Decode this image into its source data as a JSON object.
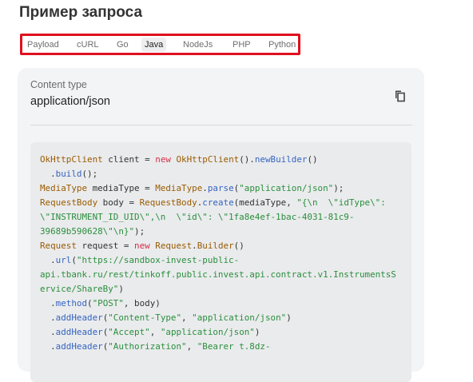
{
  "heading": "Пример запроса",
  "tabs": [
    "Payload",
    "cURL",
    "Go",
    "Java",
    "NodeJs",
    "PHP",
    "Python"
  ],
  "active_tab": "Java",
  "content_type": {
    "label": "Content type",
    "value": "application/json"
  },
  "copy_icon": "copy-icon",
  "code": {
    "language": "java",
    "lines": [
      [
        {
          "t": "OkHttpClient",
          "c": "ty"
        },
        {
          "t": " client = "
        },
        {
          "t": "new",
          "c": "kw"
        },
        {
          "t": " "
        },
        {
          "t": "OkHttpClient",
          "c": "ty"
        },
        {
          "t": "()."
        },
        {
          "t": "newBuilder",
          "c": "fn"
        },
        {
          "t": "()"
        }
      ],
      [
        {
          "t": "  ."
        },
        {
          "t": "build",
          "c": "fn"
        },
        {
          "t": "();"
        }
      ],
      [
        {
          "t": "MediaType",
          "c": "ty"
        },
        {
          "t": " mediaType = "
        },
        {
          "t": "MediaType",
          "c": "ty"
        },
        {
          "t": "."
        },
        {
          "t": "parse",
          "c": "fn"
        },
        {
          "t": "("
        },
        {
          "t": "\"application/json\"",
          "c": "st"
        },
        {
          "t": ");"
        }
      ],
      [
        {
          "t": "RequestBody",
          "c": "ty"
        },
        {
          "t": " body = "
        },
        {
          "t": "RequestBody",
          "c": "ty"
        },
        {
          "t": "."
        },
        {
          "t": "create",
          "c": "fn"
        },
        {
          "t": "(mediaType, "
        },
        {
          "t": "\"{\\n  \\\"idType\\\":",
          "c": "st"
        }
      ],
      [
        {
          "t": "\\\"INSTRUMENT_ID_UID\\\",\\n  \\\"id\\\": \\\"1fa8e4ef-1bac-4031-81c9-",
          "c": "st"
        }
      ],
      [
        {
          "t": "39689b590628\\\"\\n}\"",
          "c": "st"
        },
        {
          "t": ");"
        }
      ],
      [
        {
          "t": "Request",
          "c": "ty"
        },
        {
          "t": " request = "
        },
        {
          "t": "new",
          "c": "kw"
        },
        {
          "t": " "
        },
        {
          "t": "Request",
          "c": "ty"
        },
        {
          "t": "."
        },
        {
          "t": "Builder",
          "c": "ty"
        },
        {
          "t": "()"
        }
      ],
      [
        {
          "t": "  ."
        },
        {
          "t": "url",
          "c": "fn"
        },
        {
          "t": "("
        },
        {
          "t": "\"https://sandbox-invest-public-",
          "c": "st"
        }
      ],
      [
        {
          "t": "api.tbank.ru/rest/tinkoff.public.invest.api.contract.v1.InstrumentsS",
          "c": "st"
        }
      ],
      [
        {
          "t": "ervice/ShareBy\"",
          "c": "st"
        },
        {
          "t": ")"
        }
      ],
      [
        {
          "t": "  ."
        },
        {
          "t": "method",
          "c": "fn"
        },
        {
          "t": "("
        },
        {
          "t": "\"POST\"",
          "c": "st"
        },
        {
          "t": ", body)"
        }
      ],
      [
        {
          "t": "  ."
        },
        {
          "t": "addHeader",
          "c": "fn"
        },
        {
          "t": "("
        },
        {
          "t": "\"Content-Type\"",
          "c": "st"
        },
        {
          "t": ", "
        },
        {
          "t": "\"application/json\"",
          "c": "st"
        },
        {
          "t": ")"
        }
      ],
      [
        {
          "t": "  ."
        },
        {
          "t": "addHeader",
          "c": "fn"
        },
        {
          "t": "("
        },
        {
          "t": "\"Accept\"",
          "c": "st"
        },
        {
          "t": ", "
        },
        {
          "t": "\"application/json\"",
          "c": "st"
        },
        {
          "t": ")"
        }
      ],
      [
        {
          "t": "  ."
        },
        {
          "t": "addHeader",
          "c": "fn"
        },
        {
          "t": "("
        },
        {
          "t": "\"Authorization\"",
          "c": "st"
        },
        {
          "t": ", "
        },
        {
          "t": "\"Bearer t.8dz-",
          "c": "st"
        }
      ]
    ]
  }
}
